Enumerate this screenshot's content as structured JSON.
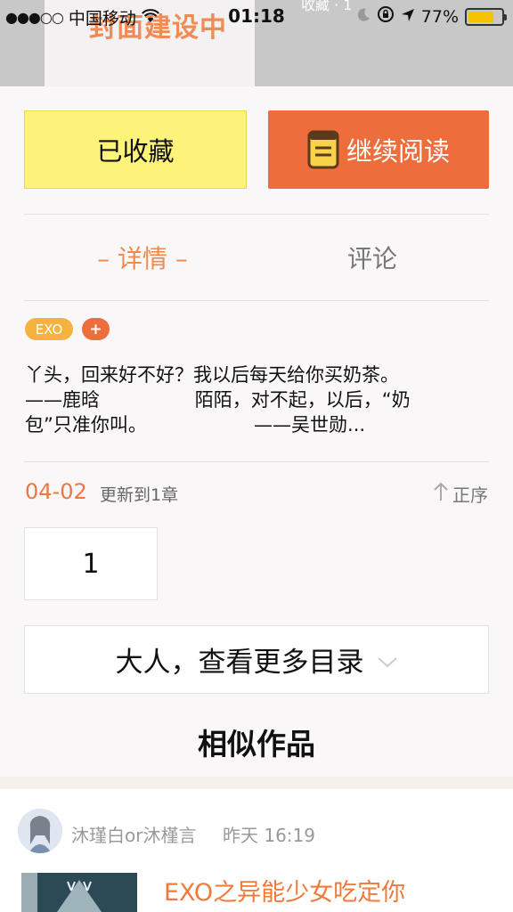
{
  "status_bar": {
    "signal_dots": "●●●○○",
    "carrier": "中国移动",
    "time": "01:18",
    "battery_percent": "77%",
    "battery_level": 0.77,
    "icons": [
      "wifi-icon",
      "moon-icon",
      "lock-rotation-icon",
      "location-arrow-icon",
      "battery-icon"
    ]
  },
  "header": {
    "cover_title": "封面建设中",
    "faint_text": "收藏 · 1"
  },
  "actions": {
    "collected_label": "已收藏",
    "continue_label": "继续阅读"
  },
  "tabs": [
    {
      "label": "– 详情 –",
      "active": true
    },
    {
      "label": "评论",
      "active": false
    }
  ],
  "tags": {
    "exo": "EXO",
    "add": "+"
  },
  "synopsis_lines": [
    "丫头，回来好不好？我以后每天给你买奶茶。",
    "——鹿晗                陌陌，对不起，以后，“奶",
    "包”只准你叫。                  ——吴世勋..."
  ],
  "update": {
    "date": "04-02",
    "text": "更新到1章",
    "order_label": "正序"
  },
  "chapter_number": "1",
  "more_catalog": "大人，查看更多目录",
  "similar_title": "相似作品",
  "feed_item": {
    "author": "沐瑾白or沐槿言",
    "time": "昨天 16:19",
    "work_title": "EXO之异能少女吃定你"
  },
  "colors": {
    "accent_orange": "#ed6d3c",
    "collected_yellow": "#fdf27a",
    "tag_yellow": "#f6b23f",
    "battery_yellow": "#f5c400"
  }
}
